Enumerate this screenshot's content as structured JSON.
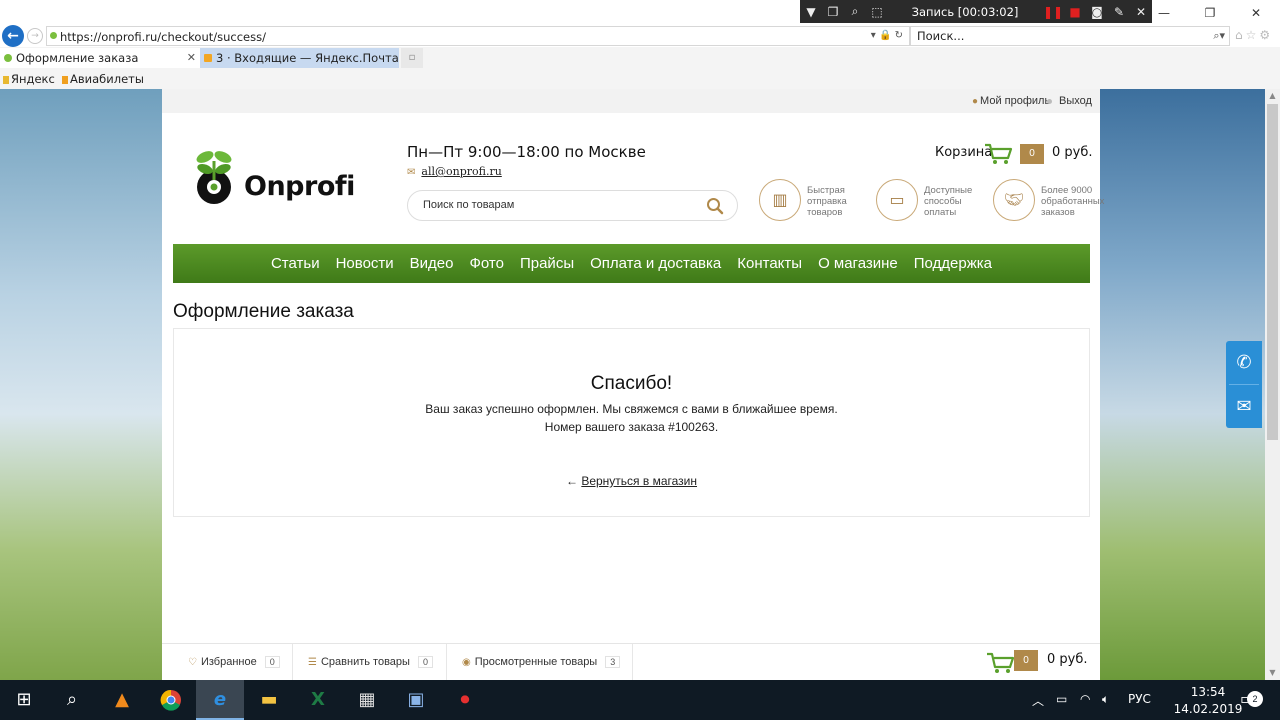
{
  "browser": {
    "recorder_title": "Запись [00:03:02]",
    "address": "https://onprofi.ru/checkout/success/",
    "search_placeholder": "Поиск...",
    "tabs": [
      {
        "label": "Оформление заказа"
      },
      {
        "label": "3 · Входящие — Яндекс.Почта"
      }
    ],
    "favorites": [
      {
        "label": "Яндекс"
      },
      {
        "label": "Авиабилеты"
      }
    ]
  },
  "site": {
    "topbar": {
      "profile": "Мой профиль",
      "logout": "Выход"
    },
    "logo_text": "Onprofi",
    "work_hours": "Пн—Пт 9:00—18:00 по Москве",
    "email": "all@onprofi.ru",
    "search_placeholder": "Поиск по товарам",
    "cart": {
      "label": "Корзина",
      "count": "0",
      "total": "0 руб."
    },
    "features": [
      {
        "icon": "box-icon",
        "lines": [
          "Быстрая",
          "отправка",
          "товаров"
        ]
      },
      {
        "icon": "card-icon",
        "lines": [
          "Доступные",
          "способы",
          "оплаты"
        ]
      },
      {
        "icon": "handshake-icon",
        "lines": [
          "Более 9000",
          "обработанных",
          "заказов"
        ]
      }
    ],
    "menu": [
      "Статьи",
      "Новости",
      "Видео",
      "Фото",
      "Прайсы",
      "Оплата и доставка",
      "Контакты",
      "О магазине",
      "Поддержка"
    ],
    "page_title": "Оформление заказа",
    "success": {
      "title": "Спасибо!",
      "message": "Ваш заказ успешно оформлен. Мы свяжемся с вами в ближайшее время.",
      "order_line": "Номер вашего заказа #100263.",
      "back_arrow": "←",
      "back_link": "Вернуться в магазин"
    },
    "bottom_bar": {
      "favorites": {
        "label": "Избранное",
        "count": "0"
      },
      "compare": {
        "label": "Сравнить товары",
        "count": "0"
      },
      "viewed": {
        "label": "Просмотренные товары",
        "count": "3"
      },
      "cart_count": "0",
      "cart_total": "0 руб."
    }
  },
  "taskbar": {
    "language": "РУС",
    "time": "13:54",
    "date": "14.02.2019",
    "notifications": "2"
  },
  "colors": {
    "menu_green": "#4a8a20",
    "accent_gold": "#b0894a",
    "side_blue": "#2a8fd6",
    "taskbar": "#0f1a24"
  }
}
